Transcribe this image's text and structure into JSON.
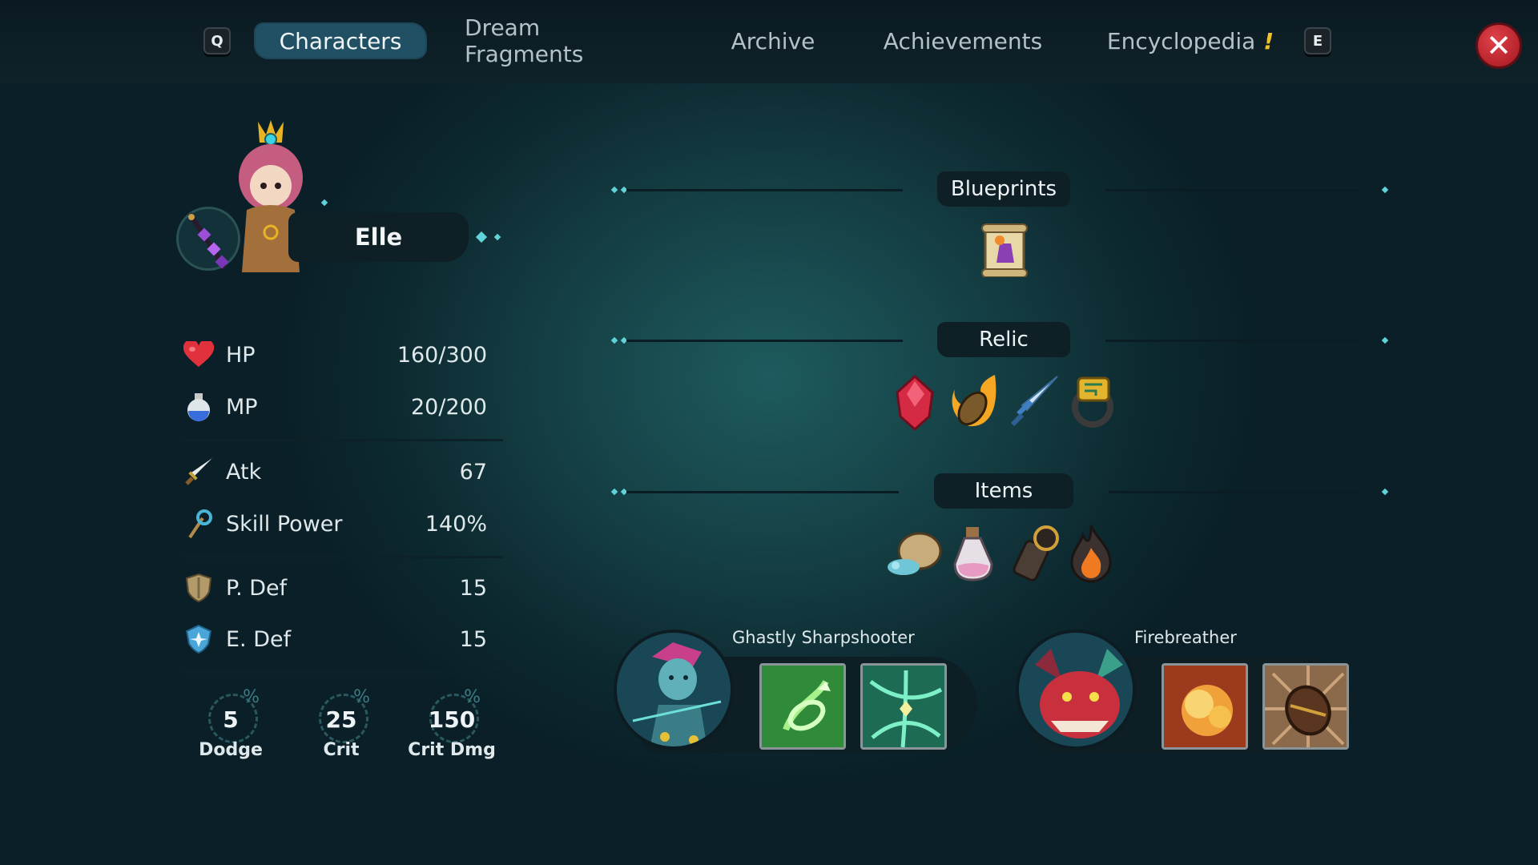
{
  "nav": {
    "left_key": "Q",
    "right_key": "E",
    "tabs": [
      {
        "label": "Characters",
        "active": true
      },
      {
        "label": "Dream Fragments",
        "active": false
      },
      {
        "label": "Archive",
        "active": false
      },
      {
        "label": "Achievements",
        "active": false
      },
      {
        "label": "Encyclopedia",
        "active": false,
        "alert": "!"
      }
    ],
    "close_icon": "close-icon"
  },
  "character": {
    "name": "Elle"
  },
  "stats": {
    "hp": {
      "label": "HP",
      "value": "160/300",
      "fill": 0.533
    },
    "mp": {
      "label": "MP",
      "value": "20/200",
      "fill": 0.1
    },
    "atk": {
      "label": "Atk",
      "value": "67"
    },
    "skill_power": {
      "label": "Skill Power",
      "value": "140%"
    },
    "p_def": {
      "label": "P. Def",
      "value": "15"
    },
    "e_def": {
      "label": "E. Def",
      "value": "15"
    },
    "dodge": {
      "label": "Dodge",
      "value": "5",
      "unit": "%"
    },
    "crit": {
      "label": "Crit",
      "value": "25",
      "unit": "%"
    },
    "crit_dmg": {
      "label": "Crit Dmg",
      "value": "150",
      "unit": "%"
    }
  },
  "sections": {
    "blueprints": {
      "title": "Blueprints",
      "items": [
        "blueprint-scroll-icon"
      ]
    },
    "relic": {
      "title": "Relic",
      "items": [
        "red-crystal-icon",
        "fire-bullet-icon",
        "dagger-icon",
        "gold-ring-icon"
      ]
    },
    "items": {
      "title": "Items",
      "items": [
        "pouch-icon",
        "potion-bottle-icon",
        "cannon-icon",
        "flame-icon"
      ]
    }
  },
  "companions": [
    {
      "name": "Ghastly Sharpshooter",
      "skills": [
        "green-arrow-skill-icon",
        "green-vortex-skill-icon"
      ]
    },
    {
      "name": "Firebreather",
      "skills": [
        "explosion-skill-icon",
        "barrel-skill-icon"
      ]
    }
  ],
  "colors": {
    "accent": "#5fd3d8",
    "active_tab": "#214f63",
    "close": "#c72a33",
    "warn": "#f0c12a"
  }
}
